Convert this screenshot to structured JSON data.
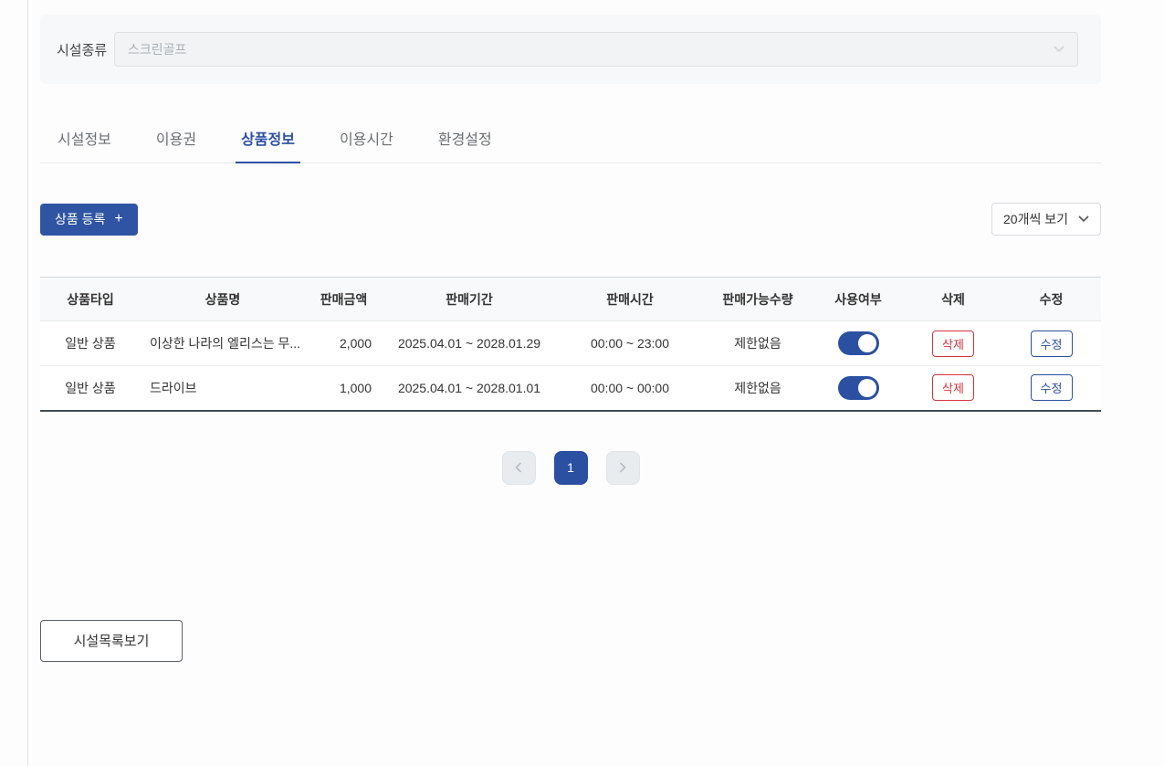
{
  "filter": {
    "label": "시설종류",
    "value": "스크린골프"
  },
  "tabs": [
    {
      "label": "시설정보",
      "active": false
    },
    {
      "label": "이용권",
      "active": false
    },
    {
      "label": "상품정보",
      "active": true
    },
    {
      "label": "이용시간",
      "active": false
    },
    {
      "label": "환경설정",
      "active": false
    }
  ],
  "toolbar": {
    "register_label": "상품 등록",
    "register_icon": "+",
    "page_size_value": "20개씩 보기"
  },
  "table": {
    "headers": [
      "상품타입",
      "상품명",
      "판매금액",
      "판매기간",
      "판매시간",
      "판매가능수량",
      "사용여부",
      "삭제",
      "수정"
    ],
    "delete_label": "삭제",
    "edit_label": "수정",
    "rows": [
      {
        "type": "일반 상품",
        "name": "이상한 나라의 엘리스는 무...",
        "price": "2,000",
        "period": "2025.04.01 ~ 2028.01.29",
        "time": "00:00 ~ 23:00",
        "quantity": "제한없음",
        "enabled": true
      },
      {
        "type": "일반 상품",
        "name": "드라이브",
        "price": "1,000",
        "period": "2025.04.01 ~ 2028.01.01",
        "time": "00:00 ~ 00:00",
        "quantity": "제한없음",
        "enabled": true
      }
    ]
  },
  "pagination": {
    "current": "1"
  },
  "footer": {
    "facility_list_label": "시설목록보기"
  },
  "colors": {
    "primary": "#2b4fa3",
    "primary_button": "#2f54a3",
    "danger": "#d6323c",
    "header_bg": "#f8f9fa",
    "panel_bg": "#f7f8f9"
  }
}
